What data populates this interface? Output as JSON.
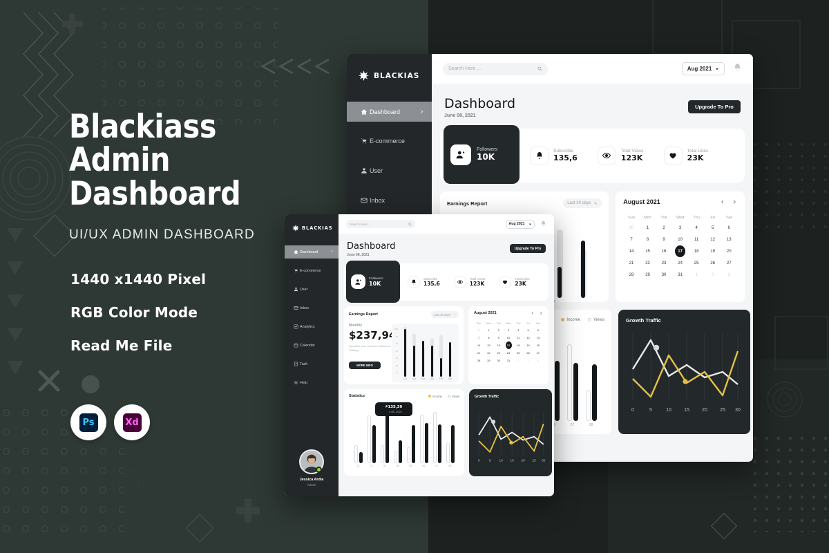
{
  "poster": {
    "title_line1": "Blackiass",
    "title_line2": "Admin Dashboard",
    "subtitle": "UI/UX ADMIN DASHBOARD",
    "features": [
      "1440 x1440 Pixel",
      "RGB Color Mode",
      "Read Me File"
    ],
    "badges": [
      {
        "name": "photoshop-badge",
        "label": "Ps"
      },
      {
        "name": "adobe-xd-badge",
        "label": "Xd"
      }
    ],
    "colors": {
      "background": "#2e3834",
      "background_right": "#1d2220",
      "text": "#ffffff",
      "accent_yellow": "#e6c244",
      "panel_dark": "#23282b"
    }
  },
  "dashboard": {
    "brand": "BLACKIAS",
    "sidebar_items": [
      {
        "label": "Dashboard",
        "icon": "home-icon",
        "active": true
      },
      {
        "label": "E-commerce",
        "icon": "cart-icon",
        "active": false
      },
      {
        "label": "User",
        "icon": "user-icon",
        "active": false
      },
      {
        "label": "Inbox",
        "icon": "mail-icon",
        "active": false
      },
      {
        "label": "Analytics",
        "icon": "chart-icon",
        "active": false
      },
      {
        "label": "Calendar",
        "icon": "calendar-icon",
        "active": false
      },
      {
        "label": "Task",
        "icon": "task-icon",
        "active": false
      },
      {
        "label": "Help",
        "icon": "gear-icon",
        "active": false
      }
    ],
    "profile": {
      "name": "Jessica Ardia",
      "role": "Admin"
    },
    "topbar": {
      "search_placeholder": "Search Here ...",
      "search_value": "",
      "date_filter": "Aug 2021",
      "bell": "bell-icon"
    },
    "header": {
      "title": "Dashboard",
      "date": "June 08, 2021",
      "cta": "Upgrade To Pro"
    },
    "stats": [
      {
        "label": "Followers",
        "value": "10K",
        "icon": "add-user-icon",
        "featured": true
      },
      {
        "label": "Subscribe",
        "value": "135,6",
        "icon": "bell-icon",
        "featured": false
      },
      {
        "label": "Total Views",
        "value": "123K",
        "icon": "eye-icon",
        "featured": false
      },
      {
        "label": "Total Likes",
        "value": "23K",
        "icon": "eye-icon",
        "featured": false
      }
    ],
    "earnings": {
      "title": "Earnings Report",
      "filter": "Last 30 days",
      "period_label": "Monthly",
      "amount": "$237,94",
      "note": "Spesifies your account method on Settings",
      "cta": "MORE INFO"
    },
    "calendar": {
      "title": "August 2021",
      "prev": "chevron-left-icon",
      "next": "chevron-right-icon",
      "weekdays": [
        "Sun",
        "Mon",
        "Tue",
        "Wed",
        "Thu",
        "Fri",
        "Sat"
      ],
      "selected_day": 17,
      "weeks": [
        [
          {
            "d": "30",
            "muted": true
          },
          {
            "d": "1"
          },
          {
            "d": "2"
          },
          {
            "d": "3"
          },
          {
            "d": "4"
          },
          {
            "d": "5"
          },
          {
            "d": "6"
          }
        ],
        [
          {
            "d": "7"
          },
          {
            "d": "8"
          },
          {
            "d": "9"
          },
          {
            "d": "10"
          },
          {
            "d": "11"
          },
          {
            "d": "12"
          },
          {
            "d": "13"
          }
        ],
        [
          {
            "d": "14"
          },
          {
            "d": "15"
          },
          {
            "d": "16"
          },
          {
            "d": "17",
            "sel": true
          },
          {
            "d": "18"
          },
          {
            "d": "19"
          },
          {
            "d": "20"
          }
        ],
        [
          {
            "d": "21"
          },
          {
            "d": "22"
          },
          {
            "d": "23"
          },
          {
            "d": "24"
          },
          {
            "d": "25"
          },
          {
            "d": "26"
          },
          {
            "d": "27"
          }
        ],
        [
          {
            "d": "28"
          },
          {
            "d": "29"
          },
          {
            "d": "30"
          },
          {
            "d": "31"
          },
          {
            "d": "1",
            "muted": true
          },
          {
            "d": "2",
            "muted": true
          },
          {
            "d": "3",
            "muted": true
          }
        ]
      ]
    },
    "statistics": {
      "title": "Statistics",
      "legend": [
        {
          "label": "Income",
          "color": "#e6c244"
        },
        {
          "label": "Views",
          "color": "#ffffff"
        }
      ],
      "tooltip": {
        "value": "$135,39",
        "date": "July 05, 2021"
      }
    },
    "growth": {
      "title": "Growth Traffic"
    }
  },
  "chart_data": [
    {
      "type": "bar",
      "title": "Earnings Report",
      "categories": [
        "Oct",
        "Nov",
        "Dec",
        "Jan",
        "Feb",
        "Mar"
      ],
      "values": [
        96,
        62,
        72,
        63,
        38,
        70
      ],
      "background_values": [
        100,
        86,
        60,
        78,
        84,
        60
      ],
      "ytick_labels": [
        "100",
        "80",
        "70",
        "60",
        "50",
        "40",
        "0"
      ],
      "ylim": [
        0,
        100
      ],
      "xlabel": "",
      "ylabel": "",
      "grid": false,
      "legend": ""
    },
    {
      "type": "bar",
      "title": "Statistics",
      "categories": [
        "01",
        "02",
        "03",
        "04",
        "05",
        "06",
        "07",
        "08"
      ],
      "series": [
        {
          "name": "Income",
          "values": [
            18,
            62,
            92,
            38,
            62,
            66,
            64,
            62
          ]
        },
        {
          "name": "Views",
          "values": [
            30,
            78,
            30,
            20,
            26,
            80,
            84,
            34
          ]
        }
      ],
      "ylim": [
        0,
        100
      ],
      "grid": false,
      "legend": "top-right"
    },
    {
      "type": "line",
      "title": "Growth Traffic",
      "x": [
        0,
        5,
        10,
        15,
        20,
        25,
        30
      ],
      "series": [
        {
          "name": "traffic-white",
          "color": "#e9ebec",
          "values": [
            48,
            82,
            38,
            52,
            36,
            42,
            28
          ]
        },
        {
          "name": "traffic-yellow",
          "color": "#e6c244",
          "values": [
            32,
            6,
            66,
            22,
            40,
            8,
            64
          ]
        }
      ],
      "xtick_labels": [
        "0",
        "5",
        "10",
        "15",
        "20",
        "25",
        "30"
      ],
      "markers": [
        {
          "series": "traffic-white",
          "x": 6.5,
          "color": "#d8dadc"
        },
        {
          "series": "traffic-yellow",
          "x": 14,
          "color": "#e6c244"
        }
      ],
      "ylim": [
        0,
        100
      ],
      "grid": true
    }
  ]
}
